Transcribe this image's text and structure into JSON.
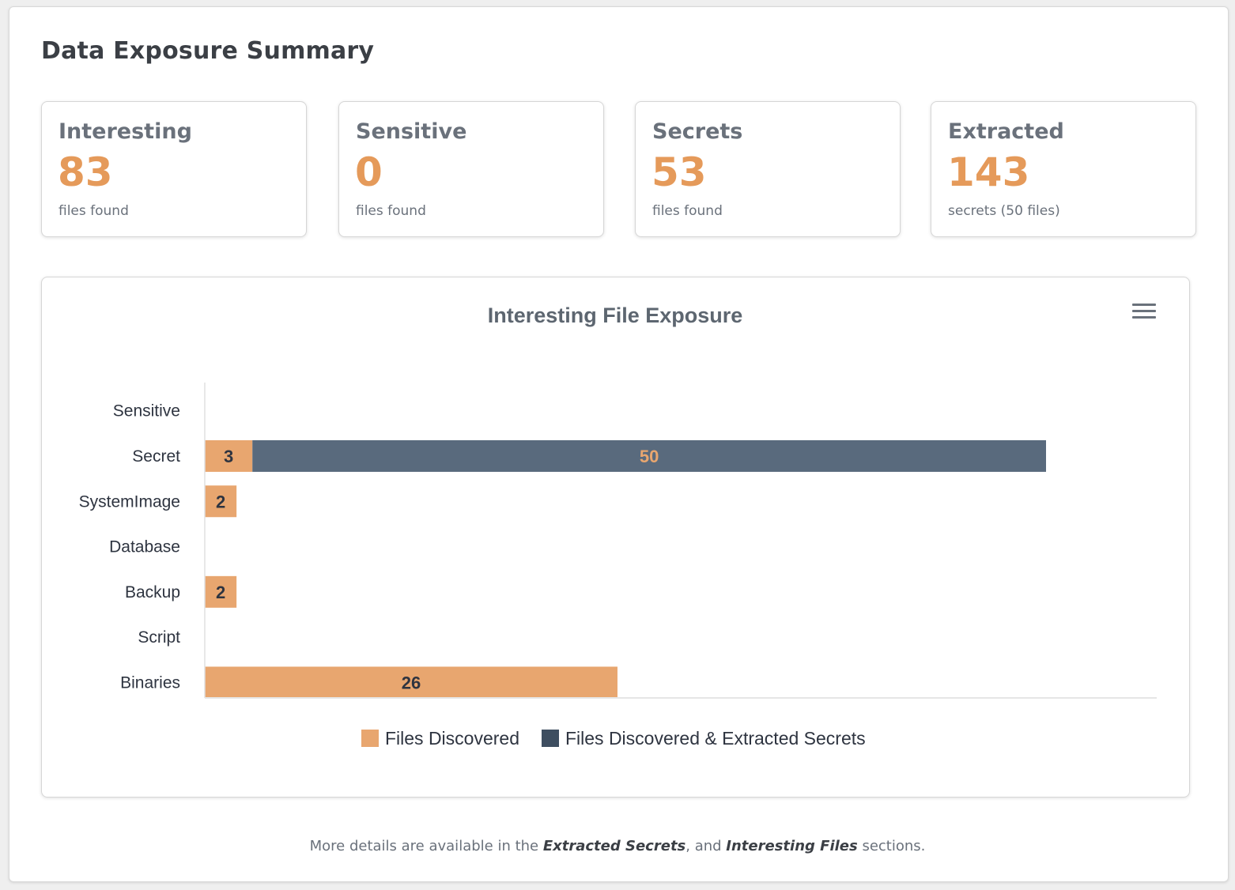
{
  "page": {
    "title": "Data Exposure Summary"
  },
  "stats": [
    {
      "label": "Interesting",
      "value": "83",
      "sub": "files found"
    },
    {
      "label": "Sensitive",
      "value": "0",
      "sub": "files found"
    },
    {
      "label": "Secrets",
      "value": "53",
      "sub": "files found"
    },
    {
      "label": "Extracted",
      "value": "143",
      "sub": "secrets (50 files)"
    }
  ],
  "chart": {
    "menu_icon": "hamburger-menu-icon"
  },
  "chart_data": {
    "type": "bar",
    "orientation": "horizontal",
    "stacked": true,
    "title": "Interesting File Exposure",
    "categories": [
      "Sensitive",
      "Secret",
      "SystemImage",
      "Database",
      "Backup",
      "Script",
      "Binaries"
    ],
    "series": [
      {
        "name": "Files Discovered",
        "color": "#e8a66f",
        "values": [
          0,
          3,
          2,
          0,
          2,
          0,
          26
        ]
      },
      {
        "name": "Files Discovered & Extracted Secrets",
        "color": "#596a7d",
        "values": [
          0,
          50,
          0,
          0,
          0,
          0,
          0
        ]
      }
    ],
    "xlim": [
      0,
      60
    ],
    "grid": false,
    "legend": "bottom-center",
    "data_label_colors": {
      "Files Discovered": "#2e3440",
      "Files Discovered & Extracted Secrets": "#e8a66f"
    },
    "legend_swatch_colors": [
      "#e8a66f",
      "#3e4e60"
    ]
  },
  "footer": {
    "prefix": "More details are available in the ",
    "link1": "Extracted Secrets",
    "middle": ", and ",
    "link2": "Interesting Files",
    "suffix": " sections."
  }
}
